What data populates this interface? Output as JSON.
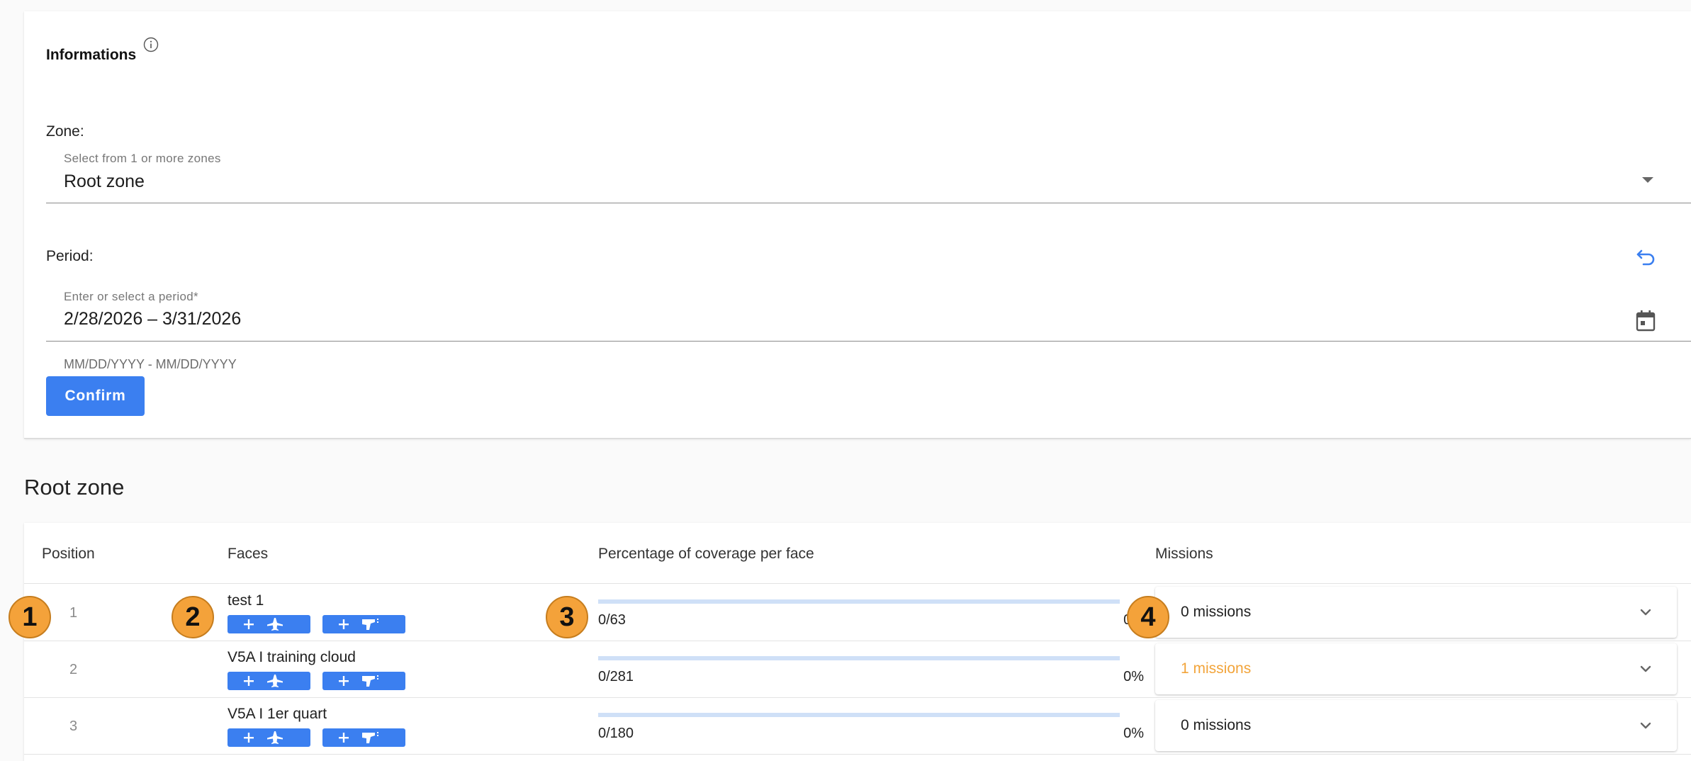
{
  "info": {
    "title": "Informations",
    "zone_label": "Zone:",
    "zone_placeholder": "Select from 1 or more zones",
    "zone_value": "Root zone",
    "period_label": "Period:",
    "period_placeholder": "Enter or select a period*",
    "period_value": "2/28/2026  – 3/31/2026",
    "period_hint": "MM/DD/YYYY - MM/DD/YYYY",
    "confirm_label": "Confirm"
  },
  "section_title": "Root zone",
  "table": {
    "headers": {
      "position": "Position",
      "faces": "Faces",
      "coverage": "Percentage of coverage per face",
      "missions": "Missions"
    },
    "rows": [
      {
        "position": "1",
        "face": "test 1",
        "ratio": "0/63",
        "percent": "0%",
        "coverage": 0,
        "missions": "0 missions",
        "missions_highlight": false
      },
      {
        "position": "2",
        "face": "V5A I training cloud",
        "ratio": "0/281",
        "percent": "0%",
        "coverage": 0,
        "missions": "1 missions",
        "missions_highlight": true
      },
      {
        "position": "3",
        "face": "V5A I 1er quart",
        "ratio": "0/180",
        "percent": "0%",
        "coverage": 0,
        "missions": "0 missions",
        "missions_highlight": false
      }
    ]
  },
  "badges": [
    "1",
    "2",
    "3",
    "4"
  ],
  "colors": {
    "accent": "#3b7ff0",
    "warning": "#f2a43a",
    "badge": "#f4a23a"
  },
  "icons": [
    "info-icon",
    "dropdown-arrow-icon",
    "undo-icon",
    "calendar-icon",
    "plus-icon",
    "airplane-icon",
    "camera-icon",
    "chevron-down-icon"
  ]
}
